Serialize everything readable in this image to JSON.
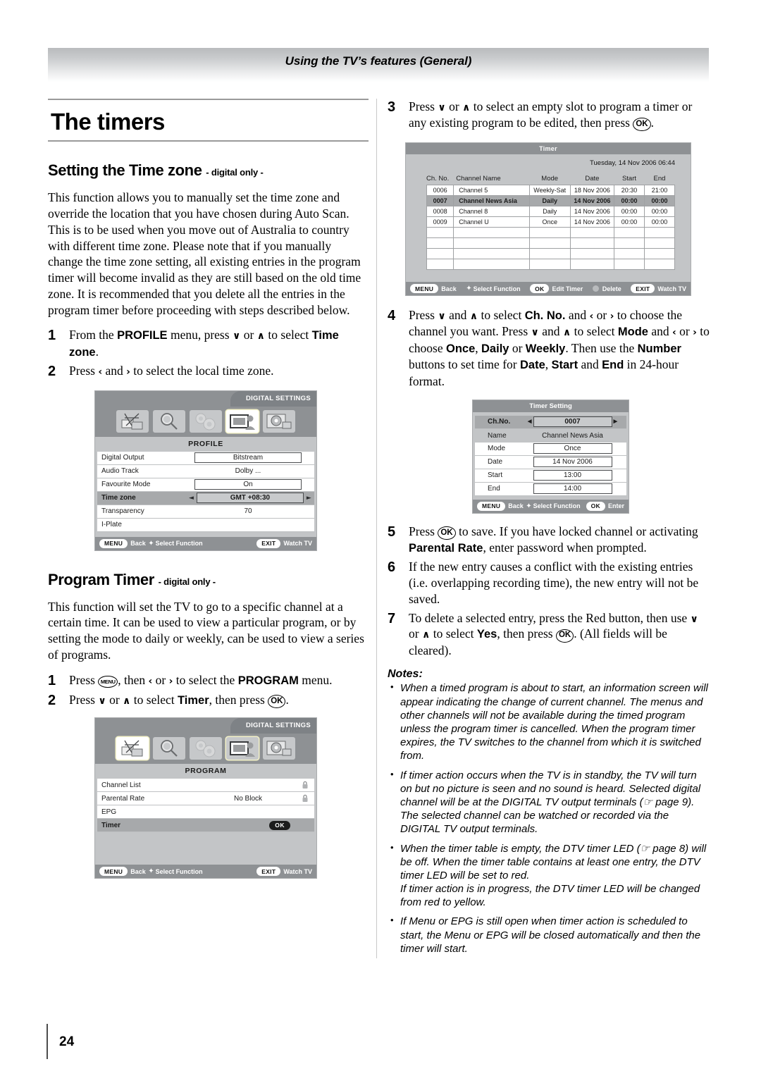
{
  "header": {
    "title": "Using the TV’s features (General)"
  },
  "left": {
    "page_heading": "The timers",
    "timezone_section": {
      "heading": "Setting the Time zone",
      "sub": "- digital only -",
      "paragraph": "This function allows you to manually set the time zone and override the location that you have chosen during Auto Scan. This is to be used when you move out of Australia to country with different time zone. Please note that if you manually change the time zone setting, all existing entries in the program timer will become invalid as they are still based on the old time zone. It is recommended that you delete all the entries in the program timer before proceeding with steps described below.",
      "step1_num": "1",
      "step2_num": "2",
      "step1_a": "From the ",
      "step1_profile": "PROFILE",
      "step1_b": " menu, press ",
      "step1_down": "∨",
      "step1_c": " or ",
      "step1_up": "∧",
      "step1_d": " to select ",
      "step1_timezone": "Time zone",
      "step1_e": ".",
      "step2_a": "Press ",
      "step2_left": "‹",
      "step2_b": " and ",
      "step2_right": "›",
      "step2_c": " to select the local time zone."
    },
    "profile_osd": {
      "digital_settings_tab": "DIGITAL SETTINGS",
      "menu_name": "PROFILE",
      "rows": [
        {
          "label": "Digital Output",
          "value": "Bitstream",
          "boxed": true,
          "selected": false
        },
        {
          "label": "Audio Track",
          "value": "Dolby ...",
          "boxed": false,
          "selected": false
        },
        {
          "label": "Favourite Mode",
          "value": "On",
          "boxed": true,
          "selected": false
        },
        {
          "label": "Time zone",
          "value": "GMT +08:30",
          "boxed": true,
          "selected": true
        },
        {
          "label": "Transparency",
          "value": "70",
          "boxed": false,
          "selected": false
        },
        {
          "label": "I-Plate",
          "value": "",
          "boxed": false,
          "selected": false
        }
      ],
      "bottom": {
        "menu_key": "MENU",
        "back": "Back",
        "select_function": "Select Function",
        "exit_key": "EXIT",
        "watch_tv": "Watch TV"
      }
    },
    "program_section": {
      "heading": "Program Timer",
      "sub": "- digital only -",
      "paragraph": "This function will set the TV to go to a specific channel at a certain time. It can be used to view a particular program, or by setting the mode to daily or weekly, can be used to view a series of programs.",
      "step1_num": "1",
      "step2_num": "2",
      "step1_a": "Press ",
      "step1_menu_key": "MENU",
      "step1_b": ", then ",
      "step1_left": "‹",
      "step1_c": " or ",
      "step1_right": "›",
      "step1_d": " to select the ",
      "step1_program": "PROGRAM",
      "step1_e": " menu.",
      "step2_a": "Press ",
      "step2_down": "∨",
      "step2_b": " or ",
      "step2_up": "∧",
      "step2_c": " to select ",
      "step2_timer": "Timer",
      "step2_d": ", then press ",
      "step2_ok": "OK",
      "step2_e": "."
    },
    "program_osd": {
      "digital_settings_tab": "DIGITAL SETTINGS",
      "menu_name": "PROGRAM",
      "rows": [
        {
          "label": "Channel List",
          "value": "",
          "lock": true,
          "ok": false,
          "selected": false
        },
        {
          "label": "Parental Rate",
          "value": "No Block",
          "lock": true,
          "ok": false,
          "selected": false
        },
        {
          "label": "EPG",
          "value": "",
          "lock": false,
          "ok": false,
          "selected": false
        },
        {
          "label": "Timer",
          "value": "",
          "lock": false,
          "ok": true,
          "selected": true
        }
      ],
      "ok_label": "OK",
      "bottom": {
        "menu_key": "MENU",
        "back": "Back",
        "select_function": "Select Function",
        "exit_key": "EXIT",
        "watch_tv": "Watch TV"
      }
    }
  },
  "right": {
    "step3": {
      "num": "3",
      "a": "Press ",
      "down": "∨",
      "b": " or ",
      "up": "∧",
      "c": " to select an empty slot to program a timer or any existing program to be edited, then press ",
      "ok": "OK",
      "d": "."
    },
    "timer_osd": {
      "title": "Timer",
      "datetime": "Tuesday, 14 Nov 2006   06:44",
      "columns": [
        "Ch. No.",
        "Channel Name",
        "Mode",
        "Date",
        "Start",
        "End"
      ],
      "rows": [
        {
          "chno": "0006",
          "name": "Channel 5",
          "mode": "Weekly-Sat",
          "date": "18 Nov 2006",
          "start": "20:30",
          "end": "21:00",
          "selected": false
        },
        {
          "chno": "0007",
          "name": "Channel News Asia",
          "mode": "Daily",
          "date": "14 Nov 2006",
          "start": "00:00",
          "end": "00:00",
          "selected": true
        },
        {
          "chno": "0008",
          "name": "Channel 8",
          "mode": "Daily",
          "date": "14 Nov 2006",
          "start": "00:00",
          "end": "00:00",
          "selected": false
        },
        {
          "chno": "0009",
          "name": "Channel U",
          "mode": "Once",
          "date": "14 Nov 2006",
          "start": "00:00",
          "end": "00:00",
          "selected": false
        },
        {
          "chno": "",
          "name": "",
          "mode": "",
          "date": "",
          "start": "",
          "end": "",
          "selected": false
        },
        {
          "chno": "",
          "name": "",
          "mode": "",
          "date": "",
          "start": "",
          "end": "",
          "selected": false
        },
        {
          "chno": "",
          "name": "",
          "mode": "",
          "date": "",
          "start": "",
          "end": "",
          "selected": false
        },
        {
          "chno": "",
          "name": "",
          "mode": "",
          "date": "",
          "start": "",
          "end": "",
          "selected": false
        }
      ],
      "bottom": {
        "menu_key": "MENU",
        "back": "Back",
        "select_function": "Select Function",
        "ok_key": "OK",
        "edit_timer": "Edit Timer",
        "delete": "Delete",
        "exit_key": "EXIT",
        "watch_tv": "Watch TV"
      }
    },
    "step4": {
      "num": "4",
      "a": "Press ",
      "down1": "∨",
      "b": " and ",
      "up1": "∧",
      "c": " to select ",
      "chno": "Ch. No.",
      "d": " and ",
      "left1": "‹",
      "e": " or ",
      "right1": "›",
      "f": " to choose the channel you want. Press ",
      "down2": "∨",
      "g": " and ",
      "up2": "∧",
      "h": " to select ",
      "mode": "Mode",
      "i": " and ",
      "left2": "‹",
      "j": " or ",
      "right2": "›",
      "k": " to choose ",
      "once": "Once",
      "l": ", ",
      "daily": "Daily",
      "m": " or ",
      "weekly": "Weekly",
      "n": ". Then use the ",
      "number": "Number",
      "o": " buttons to set time for ",
      "date": "Date",
      "p": ", ",
      "start": "Start",
      "q": " and ",
      "end": "End",
      "r": " in 24-hour format."
    },
    "timer_setting_osd": {
      "title": "Timer Setting",
      "rows": [
        {
          "label": "Ch.No.",
          "value": "0007",
          "boxed": true,
          "selected": true,
          "arrows": true
        },
        {
          "label": "Name",
          "value": "Channel News Asia",
          "boxed": false,
          "selected": false,
          "arrows": false
        },
        {
          "label": "Mode",
          "value": "Once",
          "boxed": true,
          "selected": false,
          "arrows": false
        },
        {
          "label": "Date",
          "value": "14 Nov 2006",
          "boxed": true,
          "selected": false,
          "arrows": false
        },
        {
          "label": "Start",
          "value": "13:00",
          "boxed": true,
          "selected": false,
          "arrows": false
        },
        {
          "label": "End",
          "value": "14:00",
          "boxed": true,
          "selected": false,
          "arrows": false
        }
      ],
      "bottom": {
        "menu_key": "MENU",
        "back": "Back",
        "select_function": "Select Function",
        "ok_key": "OK",
        "enter": "Enter"
      }
    },
    "step5": {
      "num": "5",
      "a": "Press ",
      "ok": "OK",
      "b": " to save. If you have locked channel or activating ",
      "parental": "Parental Rate",
      "c": ", enter password when prompted."
    },
    "step6": {
      "num": "6",
      "text": "If the new entry causes a conflict with the existing entries (i.e. overlapping recording time), the new entry will not be saved."
    },
    "step7": {
      "num": "7",
      "a": "To delete a selected entry, press the Red button, then use ",
      "down": "∨",
      "b": " or ",
      "up": "∧",
      "c": " to select ",
      "yes": "Yes",
      "d": ", then press ",
      "ok": "OK",
      "e": ". (All fields will be cleared)."
    },
    "notes": {
      "title": "Notes:",
      "items": [
        "When a timed program is about to start, an information screen will appear indicating the change of current channel. The menus and other channels will not be available during the timed program unless the program timer is cancelled. When the program timer expires, the TV switches to the channel from which it is switched from.",
        "If timer action occurs when the TV is in standby, the TV will turn on but no picture is seen and no sound is heard. Selected digital channel will be at the DIGITAL TV output terminals (☞ page 9). The selected channel can be watched or recorded via the DIGITAL TV output terminals.",
        "When the timer table is empty, the DTV timer LED (☞ page 8) will be off. When the timer table contains at least one entry, the DTV timer LED will be set to red.\nIf timer action is in progress, the DTV timer LED will be changed from red to yellow.",
        "If Menu or EPG is still open when timer action is scheduled to start, the Menu or EPG will be closed automatically and then the timer will start."
      ]
    }
  },
  "footer": {
    "page_number": "24"
  }
}
